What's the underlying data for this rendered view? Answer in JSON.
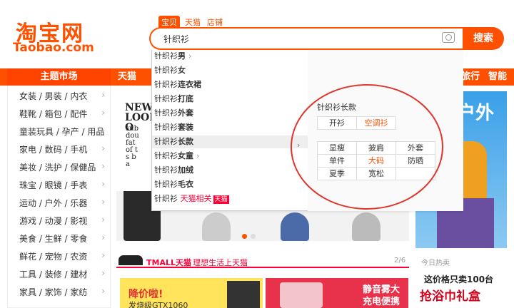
{
  "logo": {
    "zh": "淘宝网",
    "en": "Taobao.com"
  },
  "search": {
    "tabs": [
      "宝贝",
      "天猫",
      "店铺"
    ],
    "query": "针织衫",
    "button": "搜索"
  },
  "nav": {
    "category_title": "主题市场",
    "items": [
      "天猫",
      "旅行",
      "智能生"
    ]
  },
  "sidebar": {
    "categories": [
      "女装 / 男装 / 内衣",
      "鞋靴 / 箱包 / 配件",
      "童装玩具 / 孕产 / 用品",
      "家电 / 数码 / 手机",
      "美妆 / 洗护 / 保健品",
      "珠宝 / 眼镜 / 手表",
      "运动 / 户外 / 乐器",
      "游戏 / 动漫 / 影视",
      "美食 / 生鲜 / 零食",
      "鲜花 / 宠物 / 农资",
      "工具 / 装修 / 建材",
      "家具 / 家饰 / 家纺"
    ]
  },
  "banner": {
    "headline": [
      "NEW",
      "LOOK",
      "O"
    ],
    "small": [
      "sub",
      "dou",
      "fat",
      "of t",
      "s b",
      "a"
    ]
  },
  "promo_right": {
    "text": "户外"
  },
  "tmall": {
    "logo": "TMALL天猫",
    "tagline": "理想生活上天猫",
    "page": "2/6"
  },
  "hot": {
    "label": "今日热卖",
    "line1": "这价格只卖100台",
    "line2": "抢浴巾礼盒"
  },
  "promos": {
    "left_title": "降价啦!",
    "left_sub": "发烧级GTX1060",
    "mid_title": "静音雾大",
    "mid_sub": "充电便携"
  },
  "suggestions": {
    "items": [
      {
        "prefix": "针织衫",
        "suffix": "男",
        "arrow": true
      },
      {
        "prefix": "针织衫",
        "suffix": "女"
      },
      {
        "prefix": "针织衫",
        "suffix": "连衣裙"
      },
      {
        "prefix": "针织衫",
        "suffix": "打底"
      },
      {
        "prefix": "针织衫",
        "suffix": "外套"
      },
      {
        "prefix": "针织衫",
        "suffix": "套装"
      },
      {
        "prefix": "针织衫",
        "suffix": "长款",
        "highlight": true
      },
      {
        "prefix": "针织衫",
        "suffix": "女童",
        "arrow": true
      },
      {
        "prefix": "针织衫",
        "suffix": "加绒"
      },
      {
        "prefix": "针织衫",
        "suffix": "毛衣"
      },
      {
        "prefix": "针织衫",
        "tag": "天猫相关",
        "badge": "天猫"
      }
    ],
    "pane_title": "针织衫长款",
    "group1": [
      {
        "label": "开衫",
        "orange": false
      },
      {
        "label": "空调衫",
        "orange": true
      }
    ],
    "group2": [
      {
        "label": "显瘦",
        "orange": false
      },
      {
        "label": "披肩",
        "orange": false
      },
      {
        "label": "外套",
        "orange": false
      },
      {
        "label": "单件",
        "orange": false
      },
      {
        "label": "大码",
        "orange": true
      },
      {
        "label": "防晒",
        "orange": false
      },
      {
        "label": "夏季",
        "orange": false
      },
      {
        "label": "宽松",
        "orange": false
      }
    ]
  },
  "colors": {
    "accent": "#ff5000",
    "tmall": "#ff0036",
    "annotation": "#e0352c"
  }
}
